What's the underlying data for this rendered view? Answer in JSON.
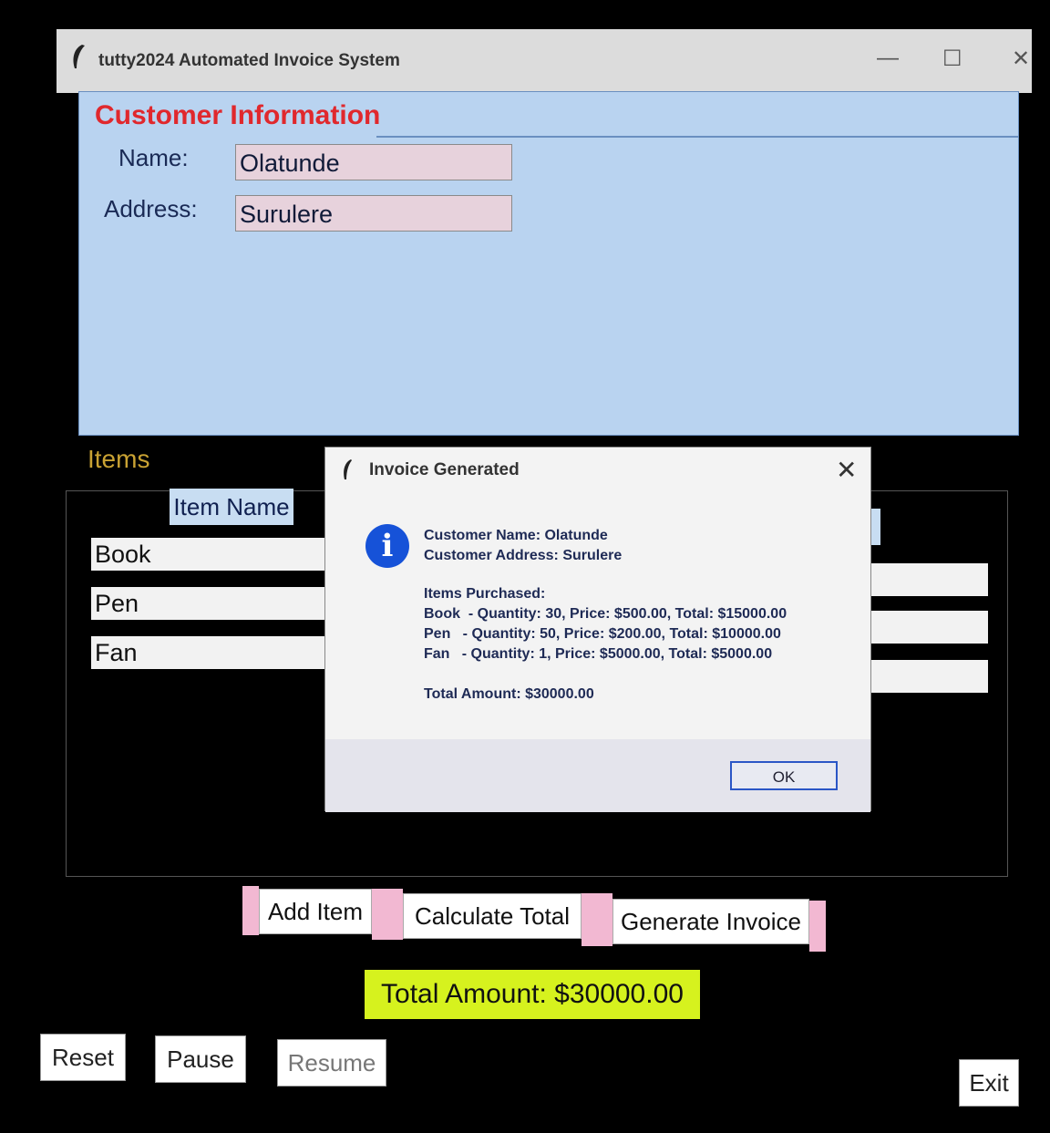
{
  "window": {
    "title": "tutty2024 Automated Invoice System",
    "minimize": "—",
    "maximize": "☐",
    "close": "✕"
  },
  "customer": {
    "legend": "Customer Information",
    "name_label": "Name:",
    "name_value": "Olatunde",
    "address_label": "Address:",
    "address_value": "Surulere"
  },
  "items": {
    "title": "Items",
    "column_header": "Item Name",
    "rows": [
      "Book",
      "Pen",
      "Fan"
    ]
  },
  "dialog": {
    "title": "Invoice Generated",
    "close": "✕",
    "customer_name": "Customer Name: Olatunde",
    "customer_address": "Customer Address: Surulere",
    "items_heading": "Items Purchased:",
    "lines": [
      "Book  - Quantity: 30, Price: $500.00, Total: $15000.00",
      "Pen   - Quantity: 50, Price: $200.00, Total: $10000.00",
      "Fan   - Quantity: 1, Price: $5000.00, Total: $5000.00"
    ],
    "total": "Total Amount: $30000.00",
    "ok_label": "OK"
  },
  "actions": {
    "add_item": "Add Item",
    "calculate_total": "Calculate Total",
    "generate_invoice": "Generate Invoice"
  },
  "total_display": "Total Amount: $30000.00",
  "controls": {
    "reset": "Reset",
    "pause": "Pause",
    "resume": "Resume",
    "exit": "Exit"
  },
  "colors": {
    "customer_panel": "#b9d3f0",
    "legend_red": "#e0282d",
    "items_gold": "#c9a233",
    "total_yellow": "#d6f21e",
    "info_blue": "#1652d8",
    "pink_spacer": "#f2b8d2"
  }
}
